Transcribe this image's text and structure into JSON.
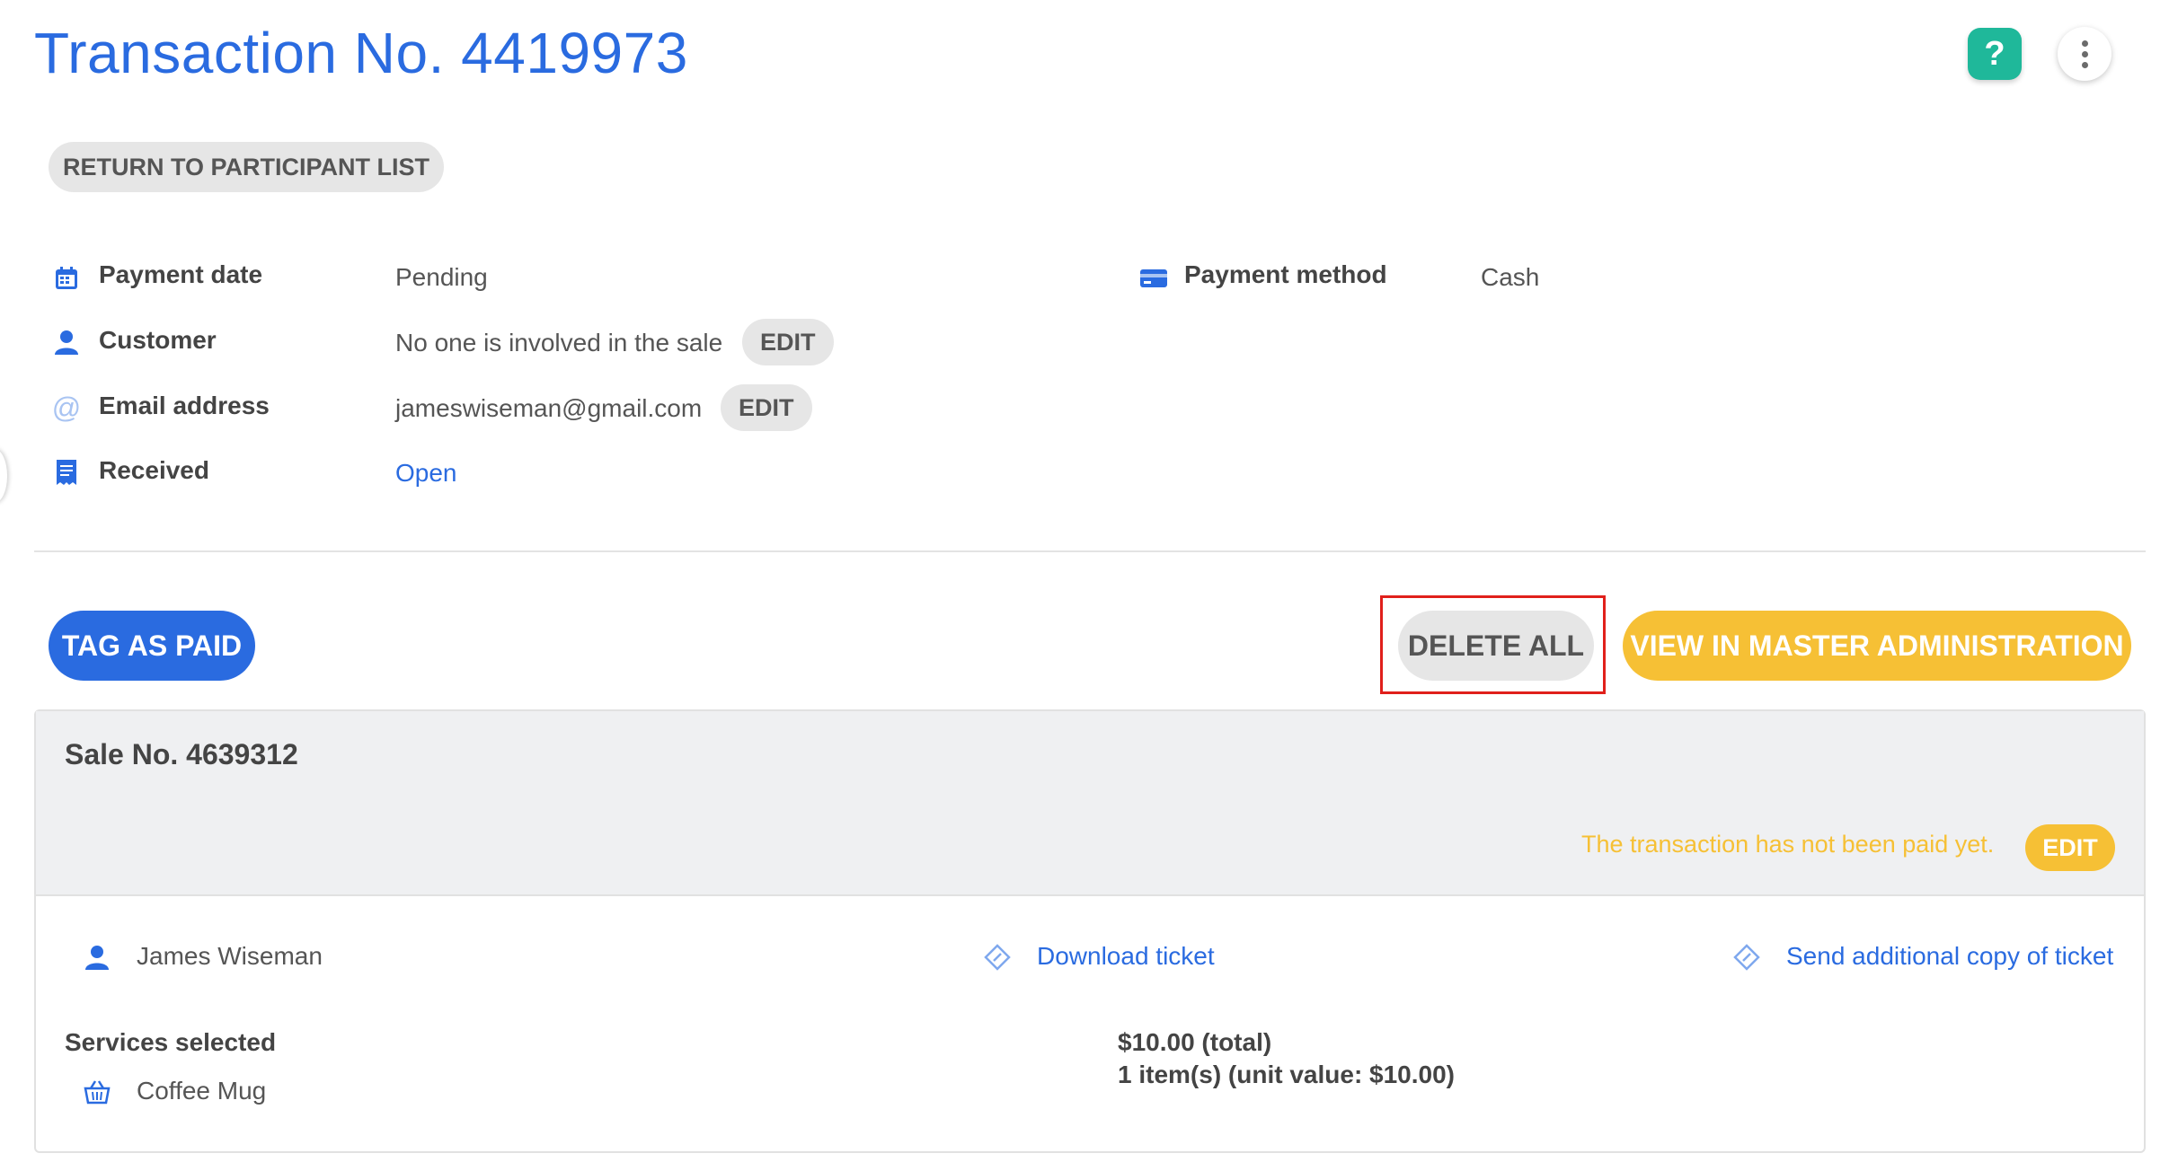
{
  "header": {
    "title": "Transaction No. 4419973",
    "help_label": "?"
  },
  "nav": {
    "return_label": "RETURN TO PARTICIPANT LIST"
  },
  "details": {
    "payment_date_label": "Payment date",
    "payment_date_value": "Pending",
    "customer_label": "Customer",
    "customer_value": "No one is involved in the sale",
    "email_label": "Email address",
    "email_value": "jameswiseman@gmail.com",
    "received_label": "Received",
    "received_value": "Open",
    "payment_method_label": "Payment method",
    "payment_method_value": "Cash",
    "edit_label": "EDIT"
  },
  "actions": {
    "tag_paid_label": "TAG AS PAID",
    "delete_all_label": "DELETE ALL",
    "view_master_label": "VIEW IN MASTER ADMINISTRATION"
  },
  "sale": {
    "title": "Sale No. 4639312",
    "status_text": "The transaction has not been paid yet.",
    "edit_label": "EDIT",
    "participant_name": "James Wiseman",
    "download_ticket_label": "Download ticket",
    "send_copy_label": "Send additional copy of ticket",
    "services_label": "Services selected",
    "service_item": "Coffee Mug",
    "total": "$10.00 (total)",
    "items": "1 item(s) (unit value: $10.00)"
  },
  "colors": {
    "primary": "#2a6be0",
    "accent_yellow": "#f6c035",
    "help_green": "#1fb89a",
    "highlight_red": "#e0201b"
  }
}
